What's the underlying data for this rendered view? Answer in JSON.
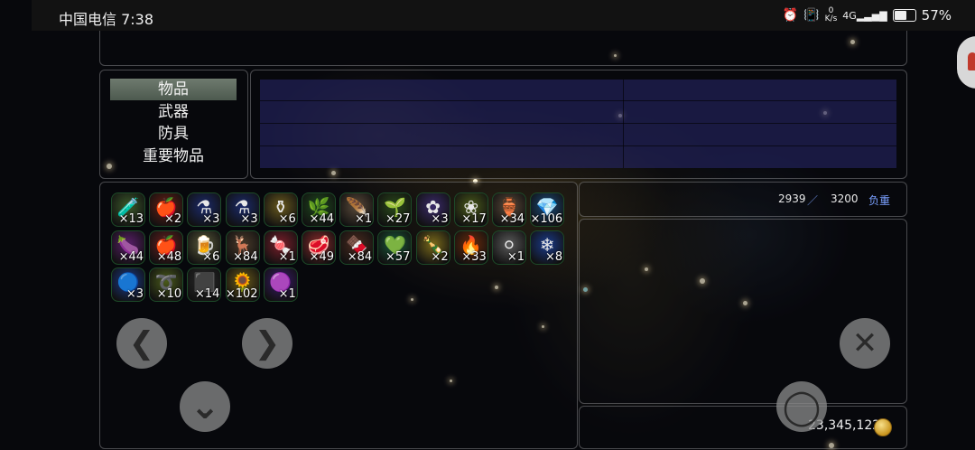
{
  "statusbar": {
    "carrier_time": "中国电信 7:38",
    "net_speed_value": "0",
    "net_speed_unit": "K/s",
    "network": "4G",
    "battery": "57%"
  },
  "menu": {
    "items": [
      "物品",
      "武器",
      "防具",
      "重要物品"
    ],
    "selected_index": 0
  },
  "weight": {
    "current": "2939",
    "separator": "／",
    "max": "3200",
    "label": "负重"
  },
  "inventory": {
    "counts": [
      "×13",
      "×2",
      "×3",
      "×3",
      "×6",
      "×44",
      "×1",
      "×27",
      "×3",
      "×17",
      "×34",
      "×106",
      "×44",
      "×48",
      "×6",
      "×84",
      "×1",
      "×49",
      "×84",
      "×57",
      "×2",
      "×33",
      "×1",
      "×8",
      "×3",
      "×10",
      "×14",
      "×102",
      "×1"
    ],
    "icons": [
      "potion-green-icon",
      "potion-red-icon",
      "potion-blue-icon",
      "potion-blue-large-icon",
      "potion-gold-icon",
      "herb-leaves-icon",
      "bundle-icon",
      "plant-sprout-icon",
      "magic-flower-icon",
      "flowers-icon",
      "urn-icon",
      "crystal-orb-icon",
      "eggplant-icon",
      "apple-icon",
      "beer-mug-icon",
      "antlers-icon",
      "candy-icon",
      "meat-icon",
      "chocolate-icon",
      "gem-green-icon",
      "bottle-icon",
      "torch-icon",
      "powder-icon",
      "ice-crystal-icon",
      "spirit-orb-icon",
      "rope-icon",
      "ore-icon",
      "sunflower-icon",
      "potion-purple-icon"
    ],
    "glyphs": [
      "🧪",
      "🍎",
      "⚗",
      "⚗",
      "⚱",
      "🌿",
      "🪶",
      "🌱",
      "✿",
      "❀",
      "🏺",
      "💎",
      "🍆",
      "🍎",
      "🍺",
      "🦌",
      "🍬",
      "🥩",
      "🍫",
      "💚",
      "🍾",
      "🔥",
      "⚪",
      "❄",
      "🔵",
      "➰",
      "⬛",
      "🌻",
      "🟣"
    ],
    "colors": [
      "#3c5a2a",
      "#6a1e14",
      "#1b2a6a",
      "#1b2a6a",
      "#6a5a1e",
      "#1e4a1e",
      "#5a4a3a",
      "#2a4a1a",
      "#3a2a6a",
      "#4a5a1a",
      "#5a4a3a",
      "#1a4a7a",
      "#5a1e6a",
      "#6a1e1e",
      "#5a5a3a",
      "#4a3a2a",
      "#7a1e2a",
      "#8a2a2a",
      "#4a2a1e",
      "#1a5a3a",
      "#7a6a1a",
      "#6a2a0a",
      "#5a5a5a",
      "#1a3a8a",
      "#1a3a8a",
      "#4a5a1a",
      "#2a2a2a",
      "#6a5a1a",
      "#3a1a6a"
    ]
  },
  "nav": {
    "left_label": "❮",
    "right_label": "❯",
    "down_label": "⌄",
    "close_label": "✕",
    "confirm_label": "◯"
  },
  "gold": {
    "amount": "23,345,122"
  }
}
